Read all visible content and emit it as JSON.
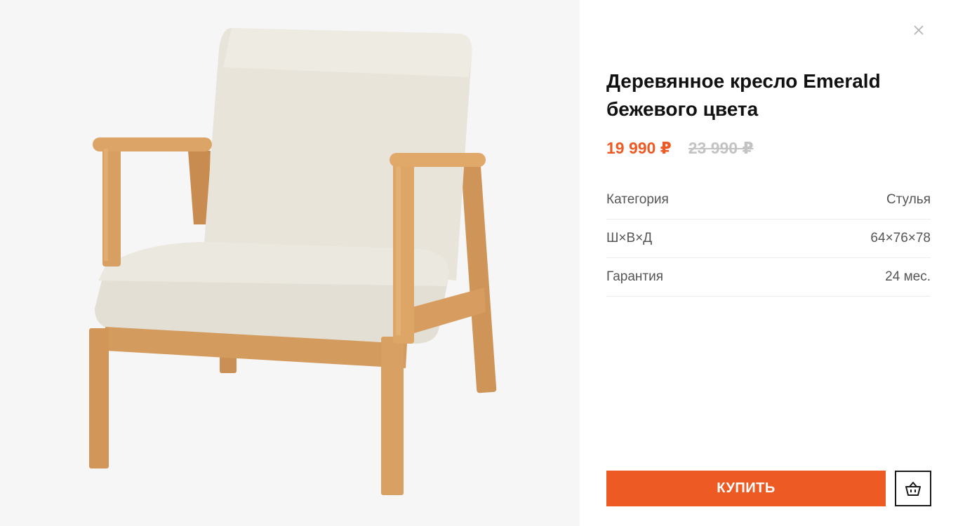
{
  "product": {
    "title": "Деревянное кресло Emerald бежевого цвета",
    "price_current": "19 990 ₽",
    "price_old": "23 990 ₽",
    "image_alt": "wooden armchair with beige upholstery"
  },
  "specs": [
    {
      "label": "Категория",
      "value": "Стулья"
    },
    {
      "label": "Ш×В×Д",
      "value": "64×76×78"
    },
    {
      "label": "Гарантия",
      "value": "24 мес."
    }
  ],
  "actions": {
    "buy_label": "КУПИТЬ",
    "cart_icon": "basket-icon",
    "close_icon": "close-icon"
  },
  "colors": {
    "accent": "#ee5a24",
    "wood": "#d9a066",
    "fabric": "#e7e3d8",
    "image_bg": "#f6f6f6"
  }
}
